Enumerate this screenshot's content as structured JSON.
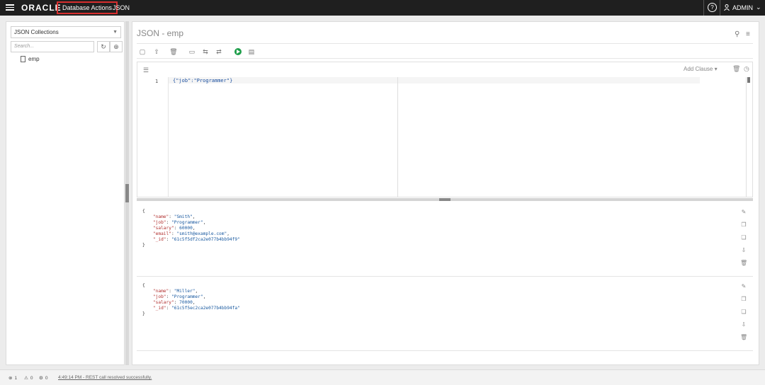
{
  "header": {
    "logo": "ORACLE",
    "app": "Database Actions",
    "section": "JSON",
    "help": "?",
    "user": "ADMIN"
  },
  "sidebar": {
    "collection_select": "JSON Collections",
    "search_placeholder": "Search...",
    "items": [
      {
        "label": "emp"
      }
    ]
  },
  "main": {
    "title": "JSON - emp",
    "editor": {
      "line_number": "1",
      "query": "{\"job\":\"Programmer\"}",
      "add_clause": "Add Clause"
    }
  },
  "results": [
    {
      "open": "{",
      "fields": [
        {
          "key": "\"name\"",
          "value": "\"Smith\"",
          "sep": ","
        },
        {
          "key": "\"job\"",
          "value": "\"Programmer\"",
          "sep": ","
        },
        {
          "key": "\"salary\"",
          "value": "60000",
          "sep": ","
        },
        {
          "key": "\"email\"",
          "value": "\"smith@example.com\"",
          "sep": ","
        },
        {
          "key": "\"_id\"",
          "value": "\"61c5f5df2ca2e077b4bb94f9\"",
          "sep": ""
        }
      ],
      "close": "}"
    },
    {
      "open": "{",
      "fields": [
        {
          "key": "\"name\"",
          "value": "\"Miller\"",
          "sep": ","
        },
        {
          "key": "\"job\"",
          "value": "\"Programmer\"",
          "sep": ","
        },
        {
          "key": "\"salary\"",
          "value": "70000",
          "sep": ","
        },
        {
          "key": "\"_id\"",
          "value": "\"61c5f5ec2ca2e077b4bb94fa\"",
          "sep": ""
        }
      ],
      "close": "}"
    }
  ],
  "footer": {
    "errors": "1",
    "warnings": "0",
    "tasks": "0",
    "status": "4:49:14 PM - REST call resolved successfully."
  }
}
